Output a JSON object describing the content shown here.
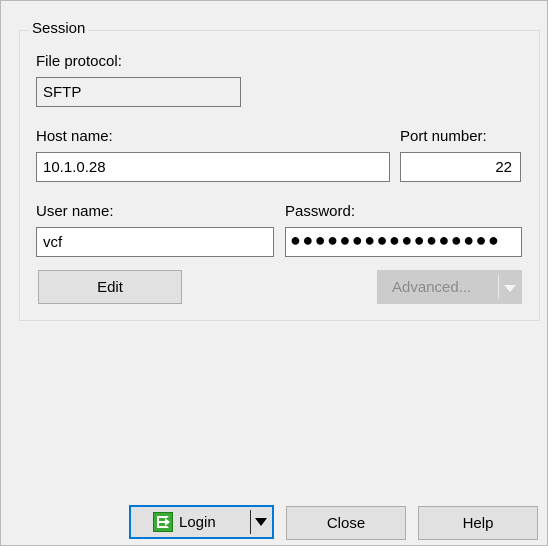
{
  "session": {
    "group_title": "Session",
    "file_protocol": {
      "label": "File protocol:",
      "value": "SFTP"
    },
    "host_name": {
      "label": "Host name:",
      "value": "10.1.0.28"
    },
    "port_number": {
      "label": "Port number:",
      "value": "22"
    },
    "user_name": {
      "label": "User name:",
      "value": "vcf"
    },
    "password": {
      "label": "Password:",
      "value": "●●●●●●●●●●●●●●●●●"
    },
    "edit_label": "Edit",
    "advanced_label": "Advanced..."
  },
  "footer": {
    "login_label": "Login",
    "close_label": "Close",
    "help_label": "Help"
  },
  "icons": {
    "login": "login-icon",
    "dropdown": "chevron-down-icon"
  },
  "colors": {
    "accent": "#0078d7",
    "login_icon": "#3aaa35",
    "window_bg": "#f0f0f0"
  }
}
